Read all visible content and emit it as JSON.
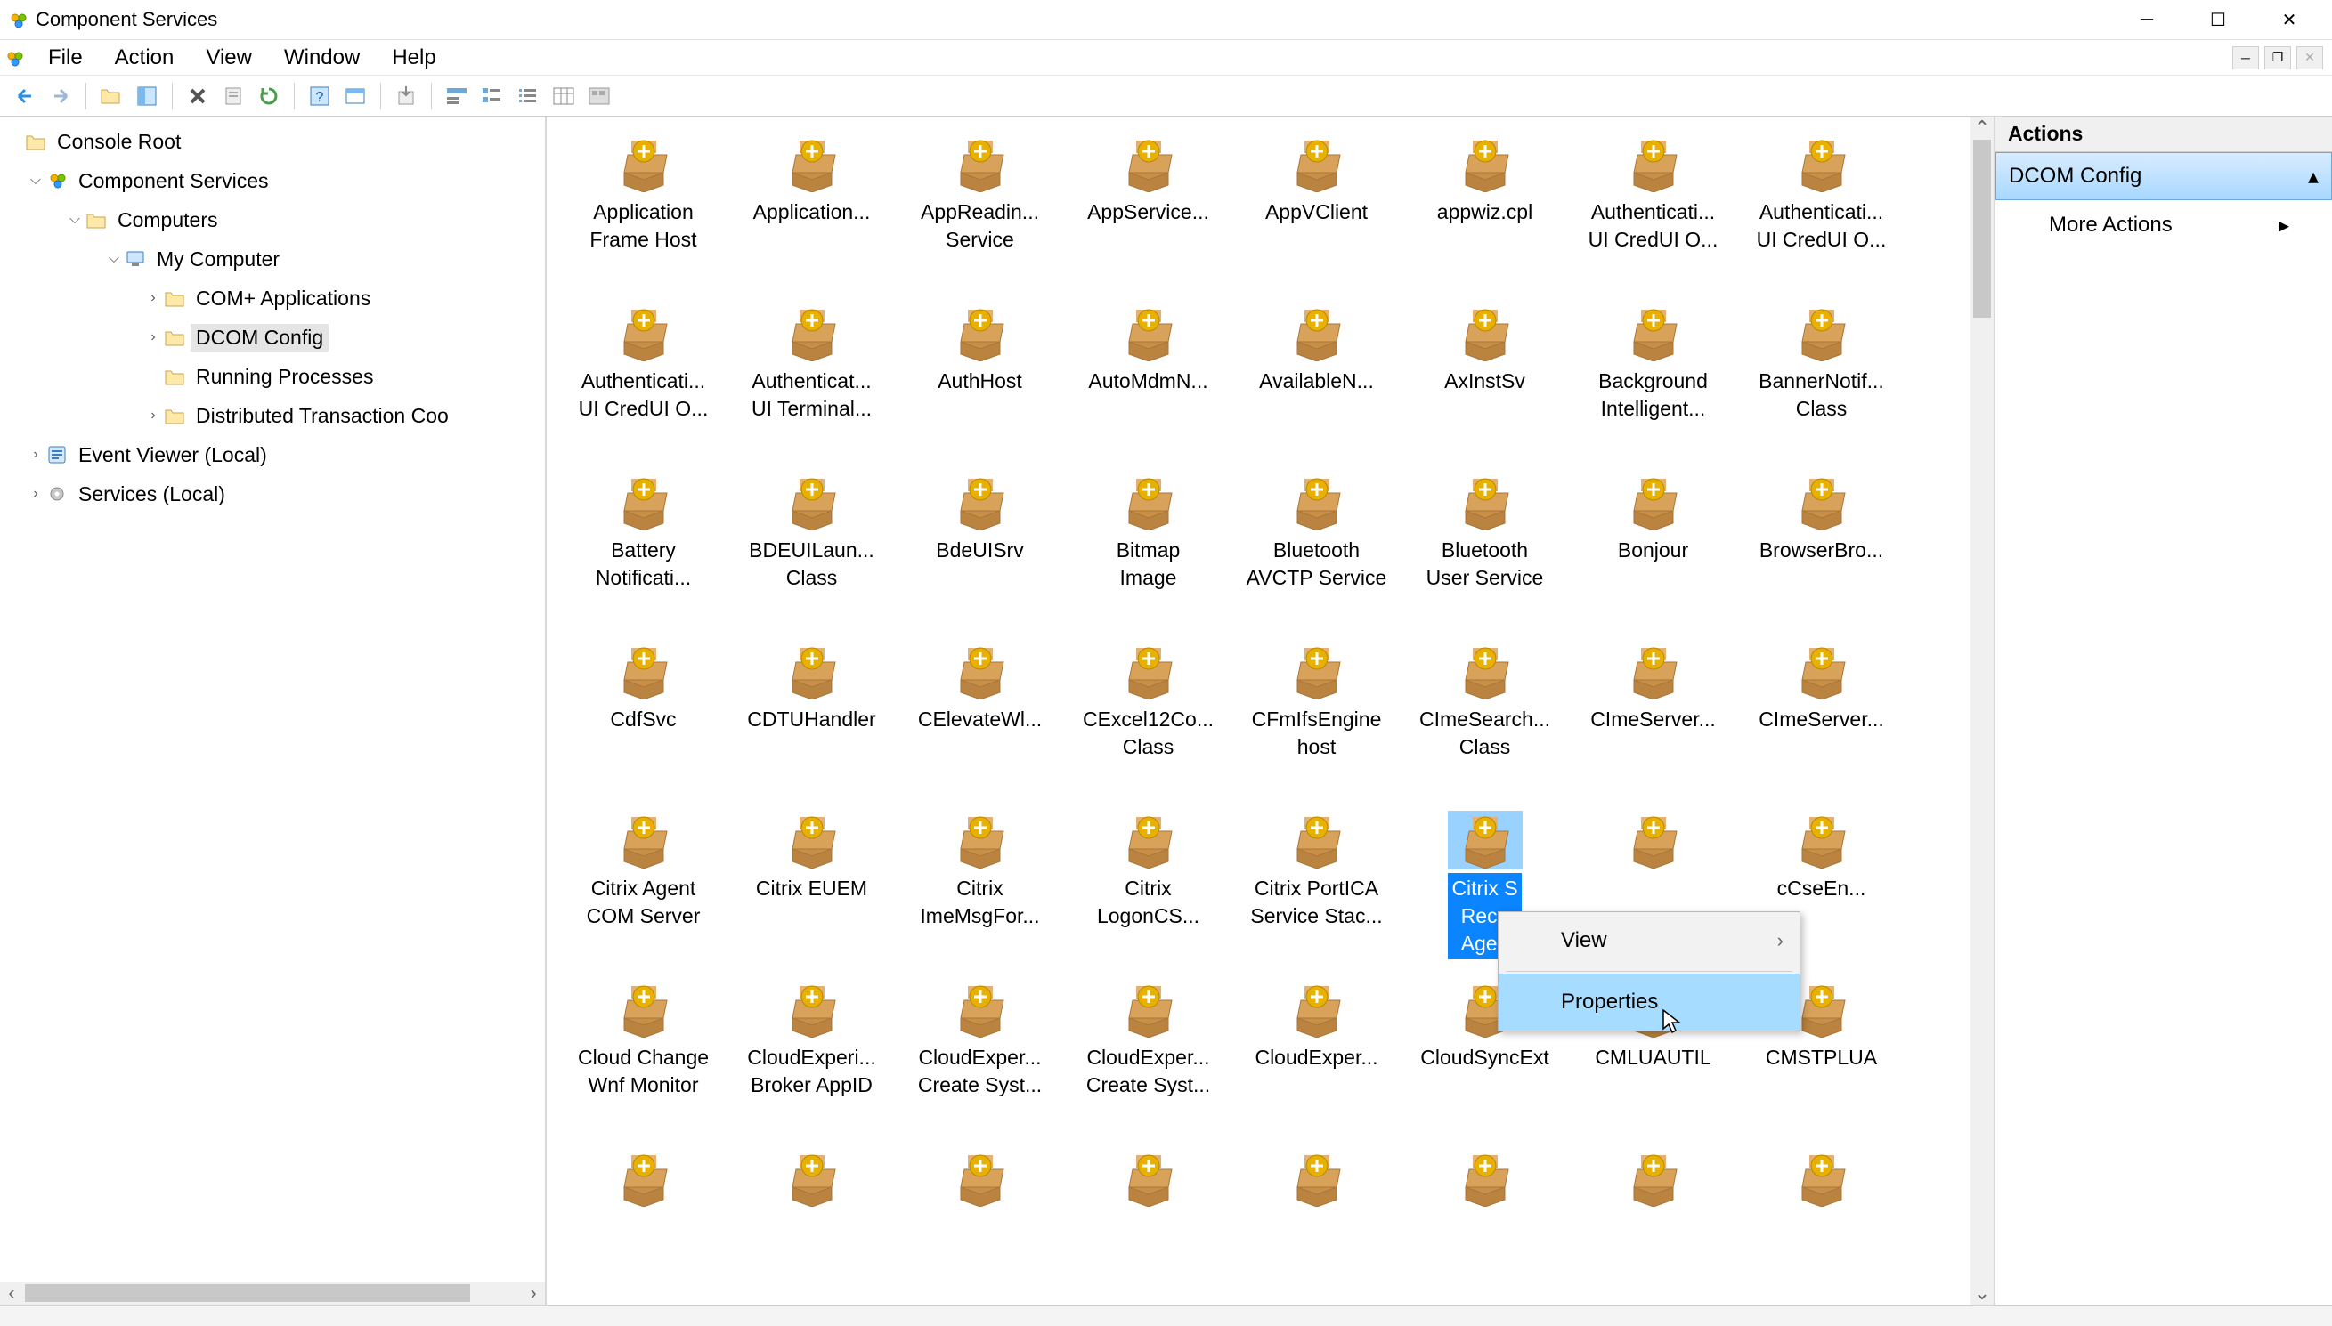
{
  "window": {
    "title": "Component Services"
  },
  "menu": {
    "file": "File",
    "action": "Action",
    "view": "View",
    "window_m": "Window",
    "help": "Help"
  },
  "tree": {
    "consoleRoot": "Console Root",
    "componentServices": "Component Services",
    "computers": "Computers",
    "myComputer": "My Computer",
    "comPlus": "COM+ Applications",
    "dcomConfig": "DCOM Config",
    "runningProcesses": "Running Processes",
    "dtc": "Distributed Transaction Coo",
    "eventViewer": "Event Viewer (Local)",
    "servicesLocal": "Services (Local)"
  },
  "actions": {
    "header": "Actions",
    "section": "DCOM Config",
    "more": "More Actions"
  },
  "contextMenu": {
    "view": "View",
    "properties": "Properties"
  },
  "dcom": {
    "items": [
      {
        "l": "Application\nFrame Host"
      },
      {
        "l": "Application..."
      },
      {
        "l": "AppReadin...\nService"
      },
      {
        "l": "AppService..."
      },
      {
        "l": "AppVClient"
      },
      {
        "l": "appwiz.cpl"
      },
      {
        "l": "Authenticati...\nUI CredUI O..."
      },
      {
        "l": "Authenticati...\nUI CredUI O..."
      },
      {
        "l": "Authenticati...\nUI CredUI O..."
      },
      {
        "l": "Authenticat...\nUI Terminal..."
      },
      {
        "l": "AuthHost"
      },
      {
        "l": "AutoMdmN..."
      },
      {
        "l": "AvailableN..."
      },
      {
        "l": "AxInstSv"
      },
      {
        "l": "Background\nIntelligent..."
      },
      {
        "l": "BannerNotif...\nClass"
      },
      {
        "l": "Battery\nNotificati..."
      },
      {
        "l": "BDEUILaun...\nClass"
      },
      {
        "l": "BdeUISrv"
      },
      {
        "l": "Bitmap\nImage"
      },
      {
        "l": "Bluetooth\nAVCTP Service"
      },
      {
        "l": "Bluetooth\nUser Service"
      },
      {
        "l": "Bonjour"
      },
      {
        "l": "BrowserBro..."
      },
      {
        "l": "CdfSvc"
      },
      {
        "l": "CDTUHandler"
      },
      {
        "l": "CElevateWl..."
      },
      {
        "l": "CExcel12Co...\nClass"
      },
      {
        "l": "CFmIfsEngine\nhost"
      },
      {
        "l": "CImeSearch...\nClass"
      },
      {
        "l": "CImeServer..."
      },
      {
        "l": "CImeServer..."
      },
      {
        "l": "Citrix Agent\nCOM Server"
      },
      {
        "l": "Citrix EUEM"
      },
      {
        "l": "Citrix\nImeMsgFor..."
      },
      {
        "l": "Citrix\nLogonCS..."
      },
      {
        "l": "Citrix PortICA\nService Stac..."
      },
      {
        "l": "Citrix S\nReco\nAgen",
        "selected": true
      },
      {
        "l": ""
      },
      {
        "l": "cCseEn..."
      },
      {
        "l": "Cloud Change\nWnf Monitor"
      },
      {
        "l": "CloudExperi...\nBroker AppID"
      },
      {
        "l": "CloudExper...\nCreate Syst..."
      },
      {
        "l": "CloudExper...\nCreate Syst..."
      },
      {
        "l": "CloudExper..."
      },
      {
        "l": "CloudSyncExt"
      },
      {
        "l": "CMLUAUTIL"
      },
      {
        "l": "CMSTPLUA"
      },
      {
        "l": ""
      },
      {
        "l": ""
      },
      {
        "l": ""
      },
      {
        "l": ""
      },
      {
        "l": ""
      },
      {
        "l": ""
      },
      {
        "l": ""
      },
      {
        "l": ""
      }
    ]
  }
}
